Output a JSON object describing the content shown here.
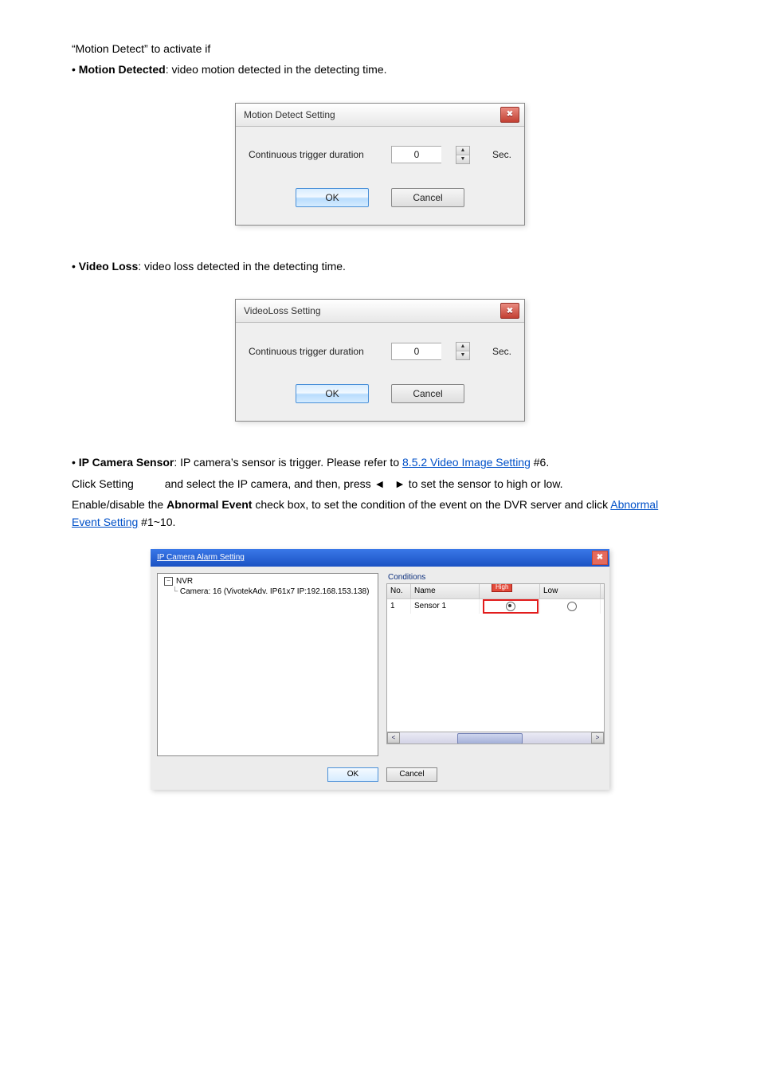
{
  "line1_text": "“Motion Detect” to activate if",
  "bullet_motion": "Motion Detected",
  "bullet_motion_suffix": ": video motion detected in the detecting time.",
  "dlg_motion": {
    "title": "Motion Detect Setting",
    "label": "Continuous trigger duration",
    "value": "0",
    "unit": "Sec.",
    "ok": "OK",
    "cancel": "Cancel"
  },
  "bullet_videoloss": "Video Loss",
  "bullet_videoloss_suffix": ": video loss detected in the detecting time.",
  "dlg_videoloss": {
    "title": "VideoLoss Setting",
    "label": "Continuous trigger duration",
    "value": "0",
    "unit": "Sec.",
    "ok": "OK",
    "cancel": "Cancel"
  },
  "bullet_ipcam": "IP Camera Sensor",
  "bullet_ipcam_suffix": ": IP camera’s sensor is trigger. Please refer to ",
  "ipcam_link": "8.5.2 Video Image Setting",
  "ipcam_tail": " #6.",
  "sensor_para_prefix": "Click Setting ",
  "sensor_para_mid": "and select the IP camera, and then, press ",
  "sensor_para_arrows": "◄   ►",
  "sensor_para_suffix": " to set the sensor to high or low.",
  "enable_line_prefix": "Enable/disable the ",
  "enable_bold": "Abnormal Event",
  "enable_line_mid": " check box, to set the condition of the event on the DVR server and click ",
  "abnormal_link": "Abnormal Event Setting",
  "abnormal_tail": " #1~10.",
  "ipdlg": {
    "title": "IP Camera Alarm Setting",
    "tree_root": "NVR",
    "tree_child": "Camera: 16 (VivotekAdv. IP61x7 IP:192.168.153.138)",
    "cond_label": "Conditions",
    "col_no": "No.",
    "col_name": "Name",
    "col_high": "High",
    "col_low": "Low",
    "row_no": "1",
    "row_name": "Sensor 1",
    "ok": "OK",
    "cancel": "Cancel"
  }
}
